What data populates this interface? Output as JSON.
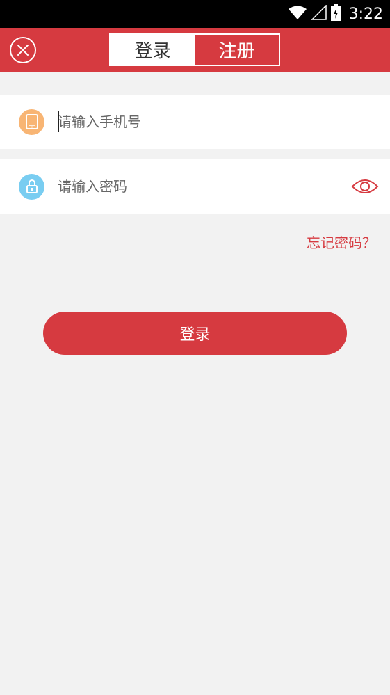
{
  "status_bar": {
    "time": "3:22",
    "icons": [
      "wifi-icon",
      "signal-icon",
      "battery-charging-icon"
    ]
  },
  "header": {
    "close_icon": "close-icon",
    "tabs": [
      {
        "label": "登录",
        "active": true
      },
      {
        "label": "注册",
        "active": false
      }
    ]
  },
  "form": {
    "phone": {
      "placeholder": "请输入手机号",
      "value": "",
      "icon": "phone-icon"
    },
    "password": {
      "placeholder": "请输入密码",
      "value": "",
      "icon": "lock-icon",
      "toggle_icon": "eye-icon"
    },
    "forgot_label": "忘记密码？",
    "submit_label": "登录"
  },
  "colors": {
    "brand": "#d63a40",
    "background": "#f2f2f2",
    "phone_icon_bg": "#f8b574",
    "lock_icon_bg": "#79cdf1"
  }
}
